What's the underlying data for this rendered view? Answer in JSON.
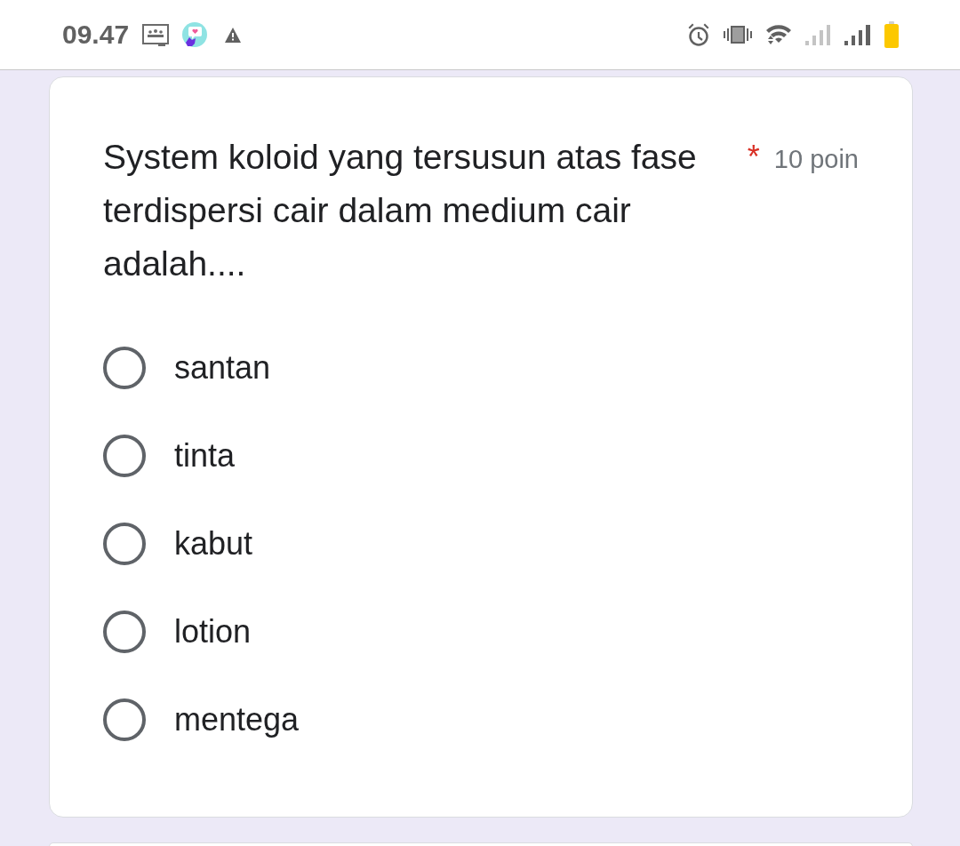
{
  "status_bar": {
    "time": "09.47"
  },
  "question": {
    "title": "System koloid yang tersusun atas fase terdispersi cair dalam medium cair adalah....",
    "required_mark": "*",
    "points": "10 poin"
  },
  "options": [
    {
      "label": "santan",
      "selected": false
    },
    {
      "label": "tinta",
      "selected": false
    },
    {
      "label": "kabut",
      "selected": false
    },
    {
      "label": "lotion",
      "selected": false
    },
    {
      "label": "mentega",
      "selected": false
    }
  ]
}
